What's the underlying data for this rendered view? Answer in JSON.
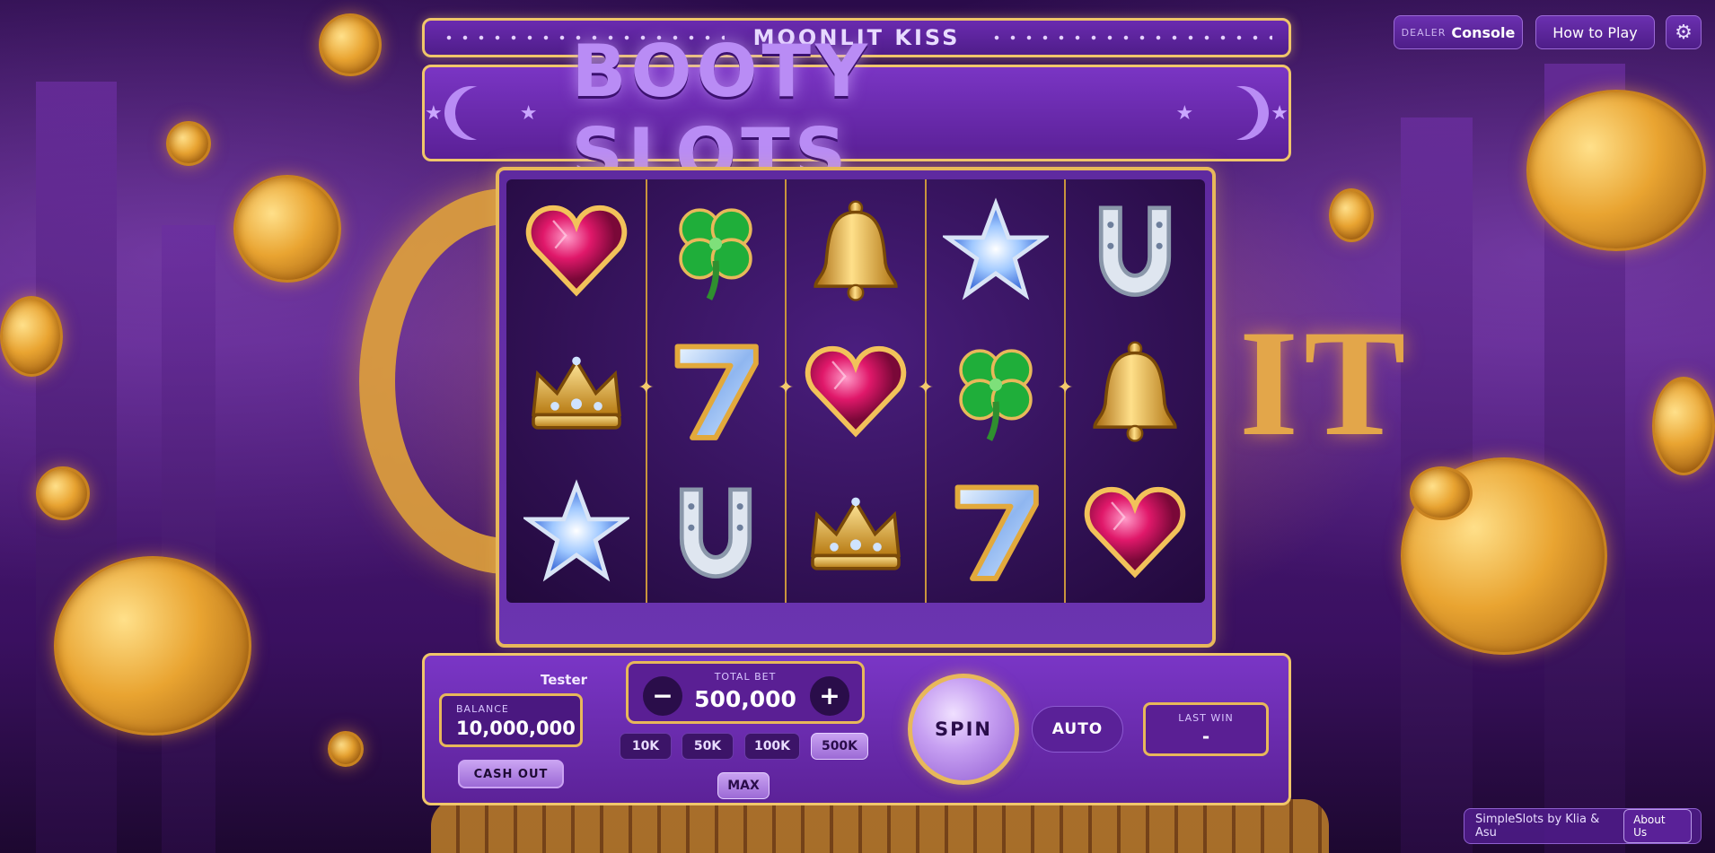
{
  "header": {
    "subtitle": "MOONLIT KISS",
    "logo": "BOOTY SLOTS"
  },
  "top_right": {
    "dealer_prefix": "DEALER",
    "dealer_label": "Console",
    "how_to_play": "How to Play",
    "settings_icon": "gear-icon"
  },
  "reels": {
    "columns": [
      [
        "heart",
        "crown",
        "star"
      ],
      [
        "clover",
        "seven",
        "horseshoe"
      ],
      [
        "bell",
        "heart",
        "crown"
      ],
      [
        "star",
        "clover",
        "seven"
      ],
      [
        "horseshoe",
        "bell",
        "heart"
      ]
    ]
  },
  "player": {
    "name": "Tester",
    "balance_label": "BALANCE",
    "balance": "10,000,000",
    "cash_out": "CASH OUT"
  },
  "bet": {
    "label": "TOTAL BET",
    "value": "500,000",
    "decrease": "−",
    "increase": "+",
    "chips": [
      "10K",
      "50K",
      "100K",
      "500K"
    ],
    "active_chip": "500K",
    "max": "MAX"
  },
  "controls": {
    "spin": "SPIN",
    "auto": "AUTO"
  },
  "last_win": {
    "label": "LAST WIN",
    "value": "-"
  },
  "footer": {
    "credit": "SimpleSlots by Klia & Asu",
    "about": "About Us"
  },
  "colors": {
    "gold": "#f0c66a",
    "purple_panel": "#6a2bb0",
    "logo_lilac": "#b98cf5"
  }
}
